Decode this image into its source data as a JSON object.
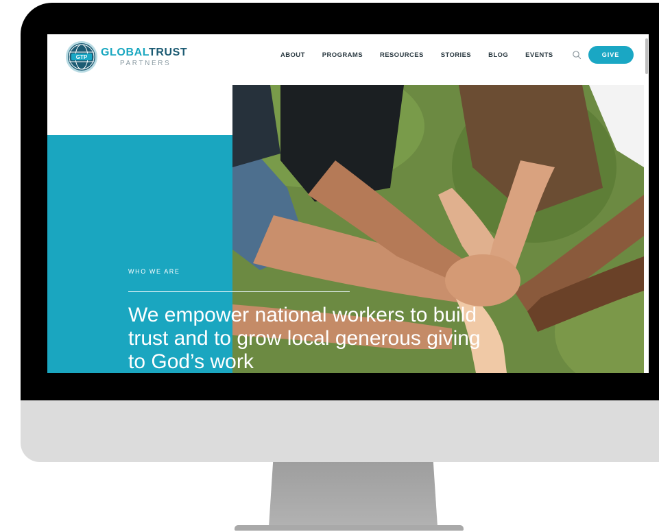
{
  "site": {
    "logo": {
      "badge_text": "GTP",
      "name_part1": "GLOBAL",
      "name_part2": "TRUST",
      "tagline": "PARTNERS"
    },
    "nav": {
      "items": [
        {
          "label": "ABOUT"
        },
        {
          "label": "PROGRAMS"
        },
        {
          "label": "RESOURCES"
        },
        {
          "label": "STORIES"
        },
        {
          "label": "BLOG"
        },
        {
          "label": "EVENTS"
        }
      ],
      "search_icon": "search-icon",
      "give_label": "GIVE"
    },
    "hero": {
      "eyebrow": "WHO WE ARE",
      "heading": "We empower national workers to build trust and to grow local generous giving to God’s work",
      "image": "stacked-hands-photo"
    }
  },
  "colors": {
    "accent_teal": "#1aa6c0",
    "logo_dark": "#1c5b73",
    "nav_text": "#2b3a42",
    "bezel": "#000000",
    "chin": "#dcdcdc",
    "stand": "#a9a9a9"
  }
}
